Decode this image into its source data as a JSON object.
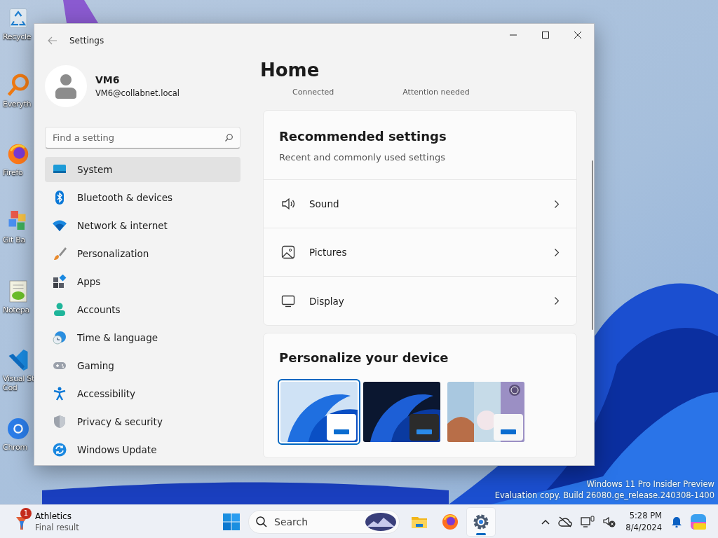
{
  "desktop": {
    "icons": [
      {
        "kind": "bin",
        "label": "Recycle"
      },
      {
        "kind": "magnifier",
        "label": "Everyth"
      },
      {
        "kind": "fox",
        "label": "Firefo"
      },
      {
        "kind": "diamond",
        "label": "Git Ba"
      },
      {
        "kind": "notepad",
        "label": "Notepa"
      },
      {
        "kind": "code",
        "label": "Visual St\nCod"
      },
      {
        "kind": "ring",
        "label": "Chrom"
      }
    ],
    "watermark": [
      "Windows 11 Pro Insider Preview",
      "Evaluation copy. Build 26080.ge_release.240308-1400"
    ]
  },
  "window": {
    "title": "Settings",
    "user": {
      "name": "VM6",
      "email": "VM6@collabnet.local"
    },
    "search": {
      "placeholder": "Find a setting"
    },
    "nav": [
      {
        "label": "System",
        "selected": true
      },
      {
        "label": "Bluetooth & devices",
        "selected": false
      },
      {
        "label": "Network & internet",
        "selected": false
      },
      {
        "label": "Personalization",
        "selected": false
      },
      {
        "label": "Apps",
        "selected": false
      },
      {
        "label": "Accounts",
        "selected": false
      },
      {
        "label": "Time & language",
        "selected": false
      },
      {
        "label": "Gaming",
        "selected": false
      },
      {
        "label": "Accessibility",
        "selected": false
      },
      {
        "label": "Privacy & security",
        "selected": false
      },
      {
        "label": "Windows Update",
        "selected": false
      }
    ],
    "page_title": "Home",
    "status_strip": [
      "Connected",
      "Attention needed"
    ],
    "recommended": {
      "title": "Recommended settings",
      "subtitle": "Recent and commonly used settings",
      "items": [
        {
          "label": "Sound"
        },
        {
          "label": "Pictures"
        },
        {
          "label": "Display"
        }
      ]
    },
    "personalize": {
      "title": "Personalize your device",
      "themes": [
        {
          "kind": "light",
          "selected": true
        },
        {
          "kind": "dark",
          "selected": false
        },
        {
          "kind": "photo",
          "selected": false
        }
      ]
    }
  },
  "taskbar": {
    "widget": {
      "badge": "1",
      "title": "Athletics",
      "subtitle": "Final result"
    },
    "search": {
      "placeholder": "Search"
    },
    "apps": [
      {
        "kind": "folder",
        "active": false
      },
      {
        "kind": "fox",
        "active": false
      },
      {
        "kind": "gear",
        "active": true
      }
    ],
    "clock": {
      "time": "5:28 PM",
      "date": "8/4/2024"
    }
  }
}
